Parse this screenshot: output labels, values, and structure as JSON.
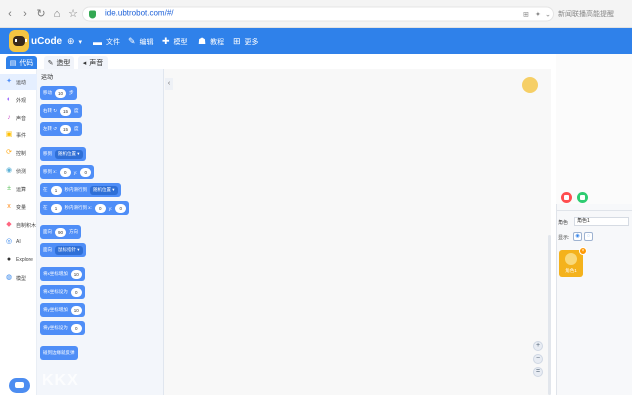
{
  "browser": {
    "url": "ide.ubtrobot.com/#/",
    "side_search": "新闻联播高能提醒"
  },
  "header": {
    "app_name": "uCode",
    "menu": [
      {
        "label": "文件",
        "icon": "folder-icon"
      },
      {
        "label": "编辑",
        "icon": "pencil-icon"
      },
      {
        "label": "模型",
        "icon": "puzzle-icon"
      },
      {
        "label": "教程",
        "icon": "people-icon"
      },
      {
        "label": "更多",
        "icon": "grid-icon"
      }
    ]
  },
  "tabs": [
    {
      "label": "代码",
      "active": true
    },
    {
      "label": "造型",
      "active": false
    },
    {
      "label": "声音",
      "active": false
    }
  ],
  "categories": [
    {
      "label": "运动",
      "color": "#4f8ef7",
      "icon": "✦"
    },
    {
      "label": "外观",
      "color": "#9966ff",
      "icon": "◐"
    },
    {
      "label": "声音",
      "color": "#cf63cf",
      "icon": "♪"
    },
    {
      "label": "事件",
      "color": "#ffbf00",
      "icon": "▣"
    },
    {
      "label": "控制",
      "color": "#ffab19",
      "icon": "⟳"
    },
    {
      "label": "侦测",
      "color": "#5cb1d6",
      "icon": "◉"
    },
    {
      "label": "运算",
      "color": "#59c059",
      "icon": "±"
    },
    {
      "label": "变量",
      "color": "#ff8c1a",
      "icon": "x"
    },
    {
      "label": "自制积木",
      "color": "#ff6680",
      "icon": "◆"
    },
    {
      "label": "AI",
      "color": "#2f81ea",
      "icon": "◎"
    },
    {
      "label": "Explore",
      "color": "#333333",
      "icon": "●"
    },
    {
      "label": "模型",
      "color": "#2f81ea",
      "icon": "◍"
    }
  ],
  "palette": {
    "title": "运动",
    "blocks": [
      {
        "parts": [
          {
            "t": "text",
            "v": "移动"
          },
          {
            "t": "pill",
            "v": "10"
          },
          {
            "t": "text",
            "v": "步"
          }
        ]
      },
      {
        "parts": [
          {
            "t": "text",
            "v": "右转 ↻"
          },
          {
            "t": "pill",
            "v": "15"
          },
          {
            "t": "text",
            "v": "度"
          }
        ]
      },
      {
        "parts": [
          {
            "t": "text",
            "v": "左转 ↺"
          },
          {
            "t": "pill",
            "v": "15"
          },
          {
            "t": "text",
            "v": "度"
          }
        ]
      },
      {
        "parts": [
          {
            "t": "text",
            "v": "移到"
          },
          {
            "t": "dd",
            "v": "随机位置 ▾"
          }
        ]
      },
      {
        "parts": [
          {
            "t": "text",
            "v": "移到 x:"
          },
          {
            "t": "pill",
            "v": "0"
          },
          {
            "t": "text",
            "v": "y:"
          },
          {
            "t": "pill",
            "v": "0"
          }
        ]
      },
      {
        "parts": [
          {
            "t": "text",
            "v": "在"
          },
          {
            "t": "pill",
            "v": "1"
          },
          {
            "t": "text",
            "v": "秒内滑行到"
          },
          {
            "t": "dd",
            "v": "随机位置 ▾"
          }
        ]
      },
      {
        "parts": [
          {
            "t": "text",
            "v": "在"
          },
          {
            "t": "pill",
            "v": "1"
          },
          {
            "t": "text",
            "v": "秒内滑行到 x:"
          },
          {
            "t": "pill",
            "v": "0"
          },
          {
            "t": "text",
            "v": "y:"
          },
          {
            "t": "pill",
            "v": "0"
          }
        ]
      },
      {
        "parts": [
          {
            "t": "text",
            "v": "面向"
          },
          {
            "t": "pill",
            "v": "90"
          },
          {
            "t": "text",
            "v": "方向"
          }
        ]
      },
      {
        "parts": [
          {
            "t": "text",
            "v": "面向"
          },
          {
            "t": "dd",
            "v": "鼠标指针 ▾"
          }
        ]
      },
      {
        "parts": [
          {
            "t": "text",
            "v": "将x坐标增加"
          },
          {
            "t": "pill",
            "v": "10"
          }
        ]
      },
      {
        "parts": [
          {
            "t": "text",
            "v": "将x坐标设为"
          },
          {
            "t": "pill",
            "v": "0"
          }
        ]
      },
      {
        "parts": [
          {
            "t": "text",
            "v": "将y坐标增加"
          },
          {
            "t": "pill",
            "v": "10"
          }
        ]
      },
      {
        "parts": [
          {
            "t": "text",
            "v": "将y坐标设为"
          },
          {
            "t": "pill",
            "v": "0"
          }
        ]
      },
      {
        "parts": [
          {
            "t": "text",
            "v": "碰到边缘就反弹"
          }
        ]
      }
    ],
    "watermark": "KKX"
  },
  "workspace": {
    "collapse_glyph": "‹",
    "zoom_in": "+",
    "zoom_out": "−",
    "zoom_reset": "="
  },
  "stage": {
    "sprite_label": "角色",
    "sprite_name": "角色1",
    "show_label": "显示:",
    "sprite_card_label": "角色1",
    "green_flag_color": "#2ecc71",
    "stop_color": "#ff4d4f"
  }
}
